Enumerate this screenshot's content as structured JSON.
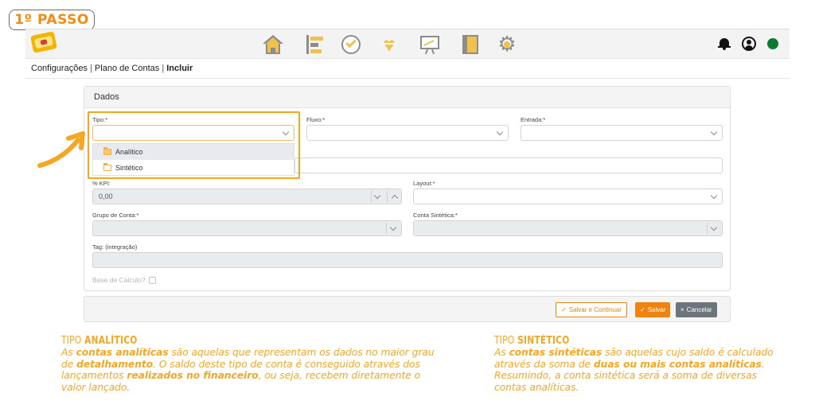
{
  "step_badge": "1º PASSO",
  "colors": {
    "accent": "#f0820f",
    "highlight": "#f5a623",
    "status_online": "#0d7a34",
    "cancel": "#6c757d"
  },
  "topbar": {
    "nav_icons": [
      "home-icon",
      "bars-icon",
      "check-circle-icon",
      "heart-pulse-icon",
      "chart-board-icon",
      "book-icon",
      "gear-icon"
    ],
    "right_icons": [
      "bell-icon",
      "user-icon",
      "status-dot"
    ]
  },
  "breadcrumb": {
    "item1": "Configurações",
    "item2": "Plano de Contas",
    "item3": "Incluir",
    "separator": "|"
  },
  "form": {
    "title": "Dados",
    "tipo_label": "Tipo:*",
    "fluxo_label": "Fluxo:*",
    "entrada_label": "Entrada:*",
    "kpi_label": "% KPI:",
    "kpi_value": "0,00",
    "layout_label": "Layout:*",
    "grupo_label": "Grupo de Conta:*",
    "sintetica_label": "Conta Sintética:*",
    "tag_label": "Tag: (integração)",
    "base_calc_label": "Base de Cálculo?"
  },
  "dropdown": {
    "options": [
      "Analítico",
      "Sintético"
    ]
  },
  "buttons": {
    "save_continue": "Salvar e Continuar",
    "save": "Salvar",
    "cancel": "Cancelar"
  },
  "analitico": {
    "title_prefix": "TIPO",
    "title_word": "ANALÍTICO",
    "t1": "As ",
    "b1": "contas analíticas",
    "t2": " são aquelas que representam os dados no maior grau de ",
    "b2": "detalhamento",
    "t3": ". O saldo deste tipo de conta é conseguido através dos lançamentos ",
    "b3": "realizados no financeiro",
    "t4": ", ou seja, recebem diretamente o valor lançado."
  },
  "sintetico": {
    "title_prefix": "TIPO",
    "title_word": "SINTÉTICO",
    "t1": "As ",
    "b1": "contas sintéticas",
    "t2": " são aquelas cujo saldo é calculado através da soma de ",
    "b2": "duas ou mais contas analíticas",
    "t3": ". Resumindo, a conta sintética será a soma de diversas contas analíticas."
  }
}
